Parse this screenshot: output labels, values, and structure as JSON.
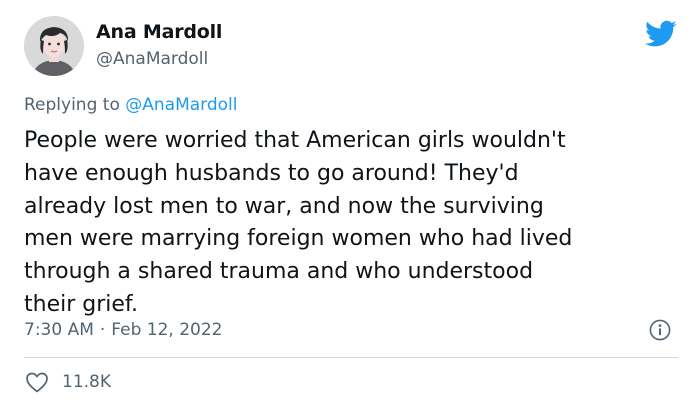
{
  "author": {
    "display_name": "Ana Mardoll",
    "handle": "@AnaMardoll",
    "avatar_icon": "profile-avatar-icon"
  },
  "reply": {
    "prefix": "Replying to ",
    "mention": "@AnaMardoll"
  },
  "tweet": {
    "text": "People were worried that American girls wouldn't\nhave enough husbands to go around! They'd\nalready lost men to war, and now the surviving\nmen were marrying foreign women who had lived\nthrough a shared trauma and who understood\ntheir grief.",
    "time": "7:30 AM",
    "separator": "·",
    "date": "Feb 12, 2022"
  },
  "engagement": {
    "likes": "11.8K",
    "like_icon": "heart-icon"
  },
  "icons": {
    "brand": "twitter-bird-icon",
    "info": "info-icon"
  },
  "colors": {
    "brand": "#1d9bf0",
    "text": "#0f1419",
    "secondary": "#536471",
    "divider": "#cfd9de"
  }
}
